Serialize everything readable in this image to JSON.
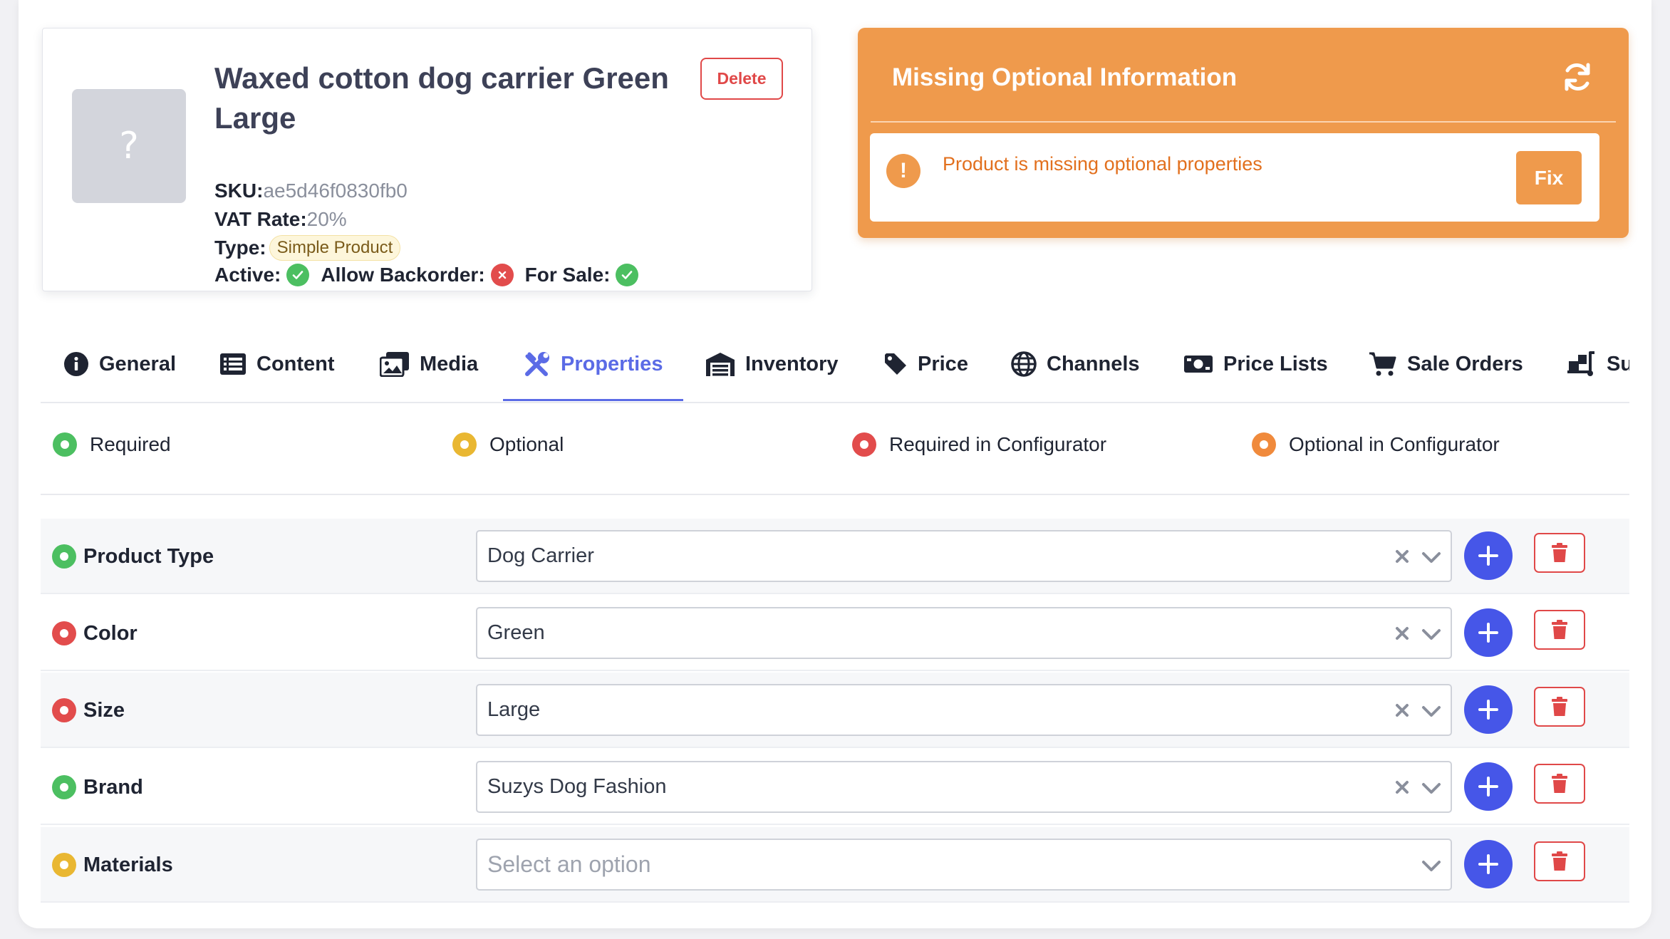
{
  "product": {
    "thumbnail_glyph": "?",
    "title": "Waxed cotton dog carrier Green Large",
    "delete_label": "Delete",
    "sku_label": "SKU:",
    "sku": "ae5d46f0830fb0",
    "vat_label": "VAT Rate:",
    "vat": "20%",
    "type_label": "Type:",
    "type": "Simple Product",
    "active_label": "Active:",
    "active": true,
    "backorder_label": "Allow Backorder:",
    "backorder": false,
    "for_sale_label": "For Sale:",
    "for_sale": true
  },
  "warning": {
    "title": "Missing Optional Information",
    "message": "Product is missing optional properties",
    "fix_label": "Fix",
    "color": "#ef9a4c"
  },
  "tabs": [
    {
      "label": "General",
      "icon": "info-circle-icon"
    },
    {
      "label": "Content",
      "icon": "list-icon"
    },
    {
      "label": "Media",
      "icon": "images-icon"
    },
    {
      "label": "Properties",
      "icon": "tools-icon",
      "active": true
    },
    {
      "label": "Inventory",
      "icon": "warehouse-icon"
    },
    {
      "label": "Price",
      "icon": "tag-icon"
    },
    {
      "label": "Channels",
      "icon": "globe-icon"
    },
    {
      "label": "Price Lists",
      "icon": "money-bill-icon"
    },
    {
      "label": "Sale Orders",
      "icon": "cart-icon"
    },
    {
      "label": "Su",
      "icon": "dolly-icon"
    }
  ],
  "legend": [
    {
      "label": "Required",
      "color": "#4cbf61"
    },
    {
      "label": "Optional",
      "color": "#e9b732"
    },
    {
      "label": "Required in Configurator",
      "color": "#e24c4c"
    },
    {
      "label": "Optional in Configurator",
      "color": "#f08a3c"
    }
  ],
  "properties": [
    {
      "label": "Product Type",
      "status": "required",
      "value": "Dog Carrier",
      "placeholder": ""
    },
    {
      "label": "Color",
      "status": "required-in-configurator",
      "value": "Green",
      "placeholder": ""
    },
    {
      "label": "Size",
      "status": "required-in-configurator",
      "value": "Large",
      "placeholder": ""
    },
    {
      "label": "Brand",
      "status": "required",
      "value": "Suzys Dog Fashion",
      "placeholder": ""
    },
    {
      "label": "Materials",
      "status": "optional",
      "value": "",
      "placeholder": "Select an option"
    }
  ],
  "colors": {
    "accent": "#5b6be6",
    "add_button": "#4656e8",
    "danger": "#e04848"
  }
}
